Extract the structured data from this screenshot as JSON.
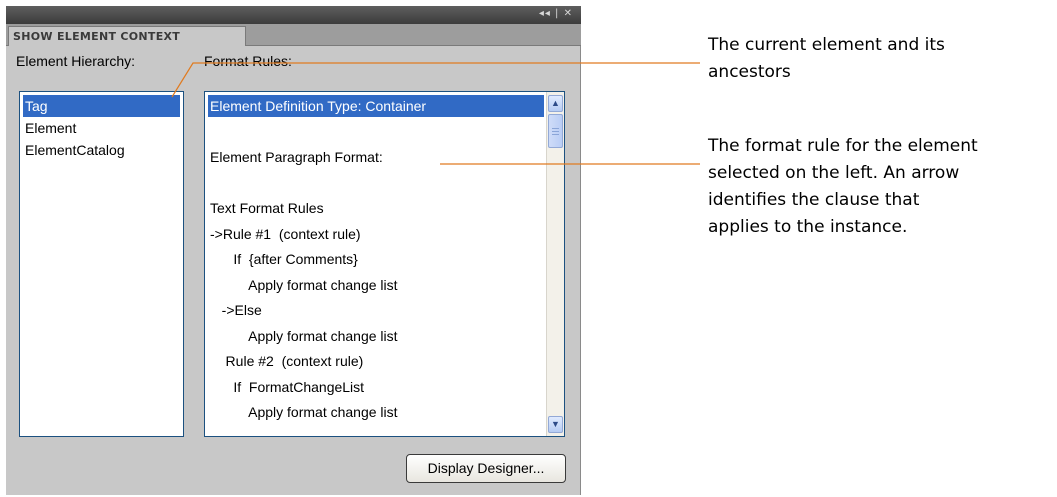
{
  "panel": {
    "tab_label": "SHOW ELEMENT CONTEXT",
    "window_controls": "◂◂ | ✕",
    "hierarchy_label": "Element Hierarchy:",
    "rules_label": "Format Rules:",
    "hierarchy_items": [
      "Tag",
      "Element",
      "ElementCatalog"
    ],
    "selected_hierarchy_index": 0,
    "rules_lines": [
      "Element Definition Type: Container",
      "",
      "Element Paragraph Format:",
      "",
      "Text Format Rules",
      "->Rule #1  (context rule)",
      "      If  {after Comments}",
      "          Apply format change list",
      "   ->Else",
      "          Apply format change list",
      "    Rule #2  (context rule)",
      "      If  FormatChangeList",
      "          Apply format change list"
    ],
    "selected_rule_index": 0,
    "display_button": "Display Designer..."
  },
  "annotations": {
    "top": [
      "The current element and its",
      "ancestors"
    ],
    "middle": [
      "The format rule for the element",
      "selected on the left. An arrow",
      "identifies the clause that",
      "applies to the instance."
    ]
  },
  "colors": {
    "callout_line": "#e07b20",
    "selection": "#316ac5"
  }
}
